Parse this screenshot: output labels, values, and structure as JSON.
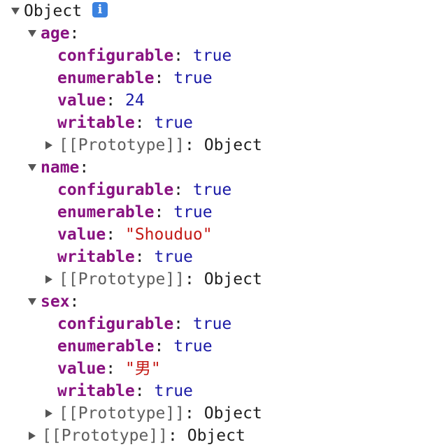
{
  "root": {
    "label": "Object",
    "info_icon": "i",
    "info_color": "#3b82e0"
  },
  "properties": [
    {
      "key": "age",
      "configurable": "true",
      "enumerable": "true",
      "value": "24",
      "writable": "true"
    },
    {
      "key": "name",
      "configurable": "true",
      "enumerable": "true",
      "value": "\"Shouduo\"",
      "writable": "true"
    },
    {
      "key": "sex",
      "configurable": "true",
      "enumerable": "true",
      "value": "\"男\"",
      "writable": "true"
    }
  ],
  "labels": {
    "configurable": "configurable",
    "enumerable": "enumerable",
    "value": "value",
    "writable": "writable",
    "colon": ":",
    "prototype": "[[Prototype]]",
    "object": "Object"
  },
  "colors": {
    "key": "#881280",
    "boolean": "#1a1aa6",
    "number": "#1a1aa6",
    "string": "#c41a16",
    "muted": "#5e5e5e"
  },
  "icons": {
    "expanded": "triangle-down-icon",
    "collapsed": "triangle-right-icon",
    "info": "info-icon"
  }
}
